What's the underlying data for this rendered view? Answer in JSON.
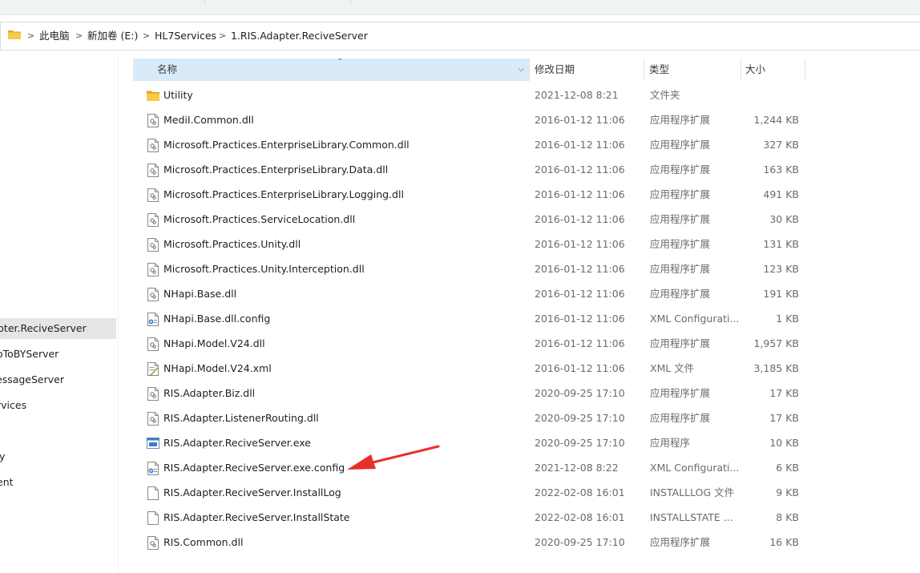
{
  "breadcrumb": {
    "items": [
      "此电脑",
      "新加卷 (E:)",
      "HL7Services",
      "1.RIS.Adapter.ReciveServer"
    ],
    "separator": ">"
  },
  "nav": {
    "items": [
      {
        "label": "pter.ReciveServer",
        "selected": true
      },
      {
        "label": "oToBYServer",
        "selected": false
      },
      {
        "label": "essageServer",
        "selected": false
      },
      {
        "label": "rvices",
        "selected": false
      },
      {
        "label": "y",
        "selected": false
      },
      {
        "label": "ent",
        "selected": false
      }
    ]
  },
  "columns": {
    "name": "名称",
    "date": "修改日期",
    "type": "类型",
    "size": "大小"
  },
  "files": [
    {
      "name": "Utility",
      "date": "2021-12-08 8:21",
      "type": "文件夹",
      "size": "",
      "icon": "folder-icon"
    },
    {
      "name": "MediI.Common.dll",
      "date": "2016-01-12 11:06",
      "type": "应用程序扩展",
      "size": "1,244 KB",
      "icon": "dll-icon"
    },
    {
      "name": "Microsoft.Practices.EnterpriseLibrary.Common.dll",
      "date": "2016-01-12 11:06",
      "type": "应用程序扩展",
      "size": "327 KB",
      "icon": "dll-icon"
    },
    {
      "name": "Microsoft.Practices.EnterpriseLibrary.Data.dll",
      "date": "2016-01-12 11:06",
      "type": "应用程序扩展",
      "size": "163 KB",
      "icon": "dll-icon"
    },
    {
      "name": "Microsoft.Practices.EnterpriseLibrary.Logging.dll",
      "date": "2016-01-12 11:06",
      "type": "应用程序扩展",
      "size": "491 KB",
      "icon": "dll-icon"
    },
    {
      "name": "Microsoft.Practices.ServiceLocation.dll",
      "date": "2016-01-12 11:06",
      "type": "应用程序扩展",
      "size": "30 KB",
      "icon": "dll-icon"
    },
    {
      "name": "Microsoft.Practices.Unity.dll",
      "date": "2016-01-12 11:06",
      "type": "应用程序扩展",
      "size": "131 KB",
      "icon": "dll-icon"
    },
    {
      "name": "Microsoft.Practices.Unity.Interception.dll",
      "date": "2016-01-12 11:06",
      "type": "应用程序扩展",
      "size": "123 KB",
      "icon": "dll-icon"
    },
    {
      "name": "NHapi.Base.dll",
      "date": "2016-01-12 11:06",
      "type": "应用程序扩展",
      "size": "191 KB",
      "icon": "dll-icon"
    },
    {
      "name": "NHapi.Base.dll.config",
      "date": "2016-01-12 11:06",
      "type": "XML Configurati...",
      "size": "1 KB",
      "icon": "config-icon"
    },
    {
      "name": "NHapi.Model.V24.dll",
      "date": "2016-01-12 11:06",
      "type": "应用程序扩展",
      "size": "1,957 KB",
      "icon": "dll-icon"
    },
    {
      "name": "NHapi.Model.V24.xml",
      "date": "2016-01-12 11:06",
      "type": "XML 文件",
      "size": "3,185 KB",
      "icon": "xml-icon"
    },
    {
      "name": "RIS.Adapter.Biz.dll",
      "date": "2020-09-25 17:10",
      "type": "应用程序扩展",
      "size": "17 KB",
      "icon": "dll-icon"
    },
    {
      "name": "RIS.Adapter.ListenerRouting.dll",
      "date": "2020-09-25 17:10",
      "type": "应用程序扩展",
      "size": "17 KB",
      "icon": "dll-icon"
    },
    {
      "name": "RIS.Adapter.ReciveServer.exe",
      "date": "2020-09-25 17:10",
      "type": "应用程序",
      "size": "10 KB",
      "icon": "exe-icon"
    },
    {
      "name": "RIS.Adapter.ReciveServer.exe.config",
      "date": "2021-12-08 8:22",
      "type": "XML Configurati...",
      "size": "6 KB",
      "icon": "config-icon"
    },
    {
      "name": "RIS.Adapter.ReciveServer.InstallLog",
      "date": "2022-02-08 16:01",
      "type": "INSTALLLOG 文件",
      "size": "9 KB",
      "icon": "blank-file-icon"
    },
    {
      "name": "RIS.Adapter.ReciveServer.InstallState",
      "date": "2022-02-08 16:01",
      "type": "INSTALLSTATE ...",
      "size": "8 KB",
      "icon": "blank-file-icon"
    },
    {
      "name": "RIS.Common.dll",
      "date": "2020-09-25 17:10",
      "type": "应用程序扩展",
      "size": "16 KB",
      "icon": "dll-icon"
    }
  ],
  "colors": {
    "header_selected": "#d9ebf9",
    "nav_selected": "#e5e5e5",
    "folder": "#f5c342",
    "annotation_arrow": "#e8302a"
  }
}
